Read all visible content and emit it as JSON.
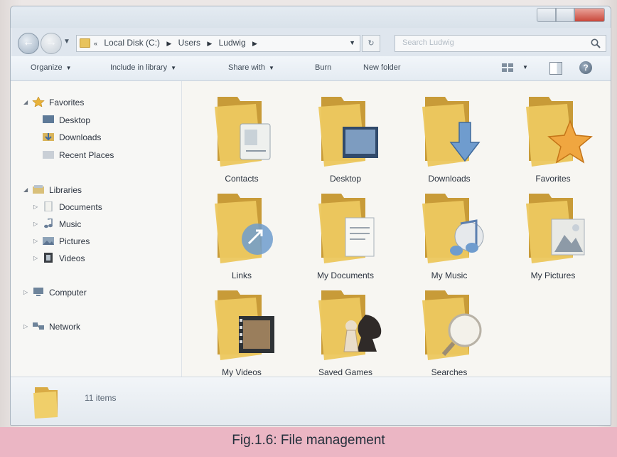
{
  "navbar": {
    "breadcrumbs": [
      "Local Disk (C:)",
      "Users",
      "Ludwig"
    ],
    "search_placeholder": "Search Ludwig"
  },
  "toolbar": {
    "organize": "Organize",
    "include_in_library": "Include in library",
    "share_with": "Share with",
    "burn": "Burn",
    "new_folder": "New folder"
  },
  "sidebar": {
    "favorites": {
      "label": "Favorites",
      "items": [
        "Desktop",
        "Downloads",
        "Recent Places"
      ]
    },
    "libraries": {
      "label": "Libraries",
      "items": [
        "Documents",
        "Music",
        "Pictures",
        "Videos"
      ]
    },
    "computer": "Computer",
    "network": "Network"
  },
  "folders": [
    {
      "name": "Contacts",
      "icon": "contact-card-icon"
    },
    {
      "name": "Desktop",
      "icon": "desktop-screen-icon"
    },
    {
      "name": "Downloads",
      "icon": "download-arrow-icon"
    },
    {
      "name": "Favorites",
      "icon": "star-icon"
    },
    {
      "name": "Links",
      "icon": "link-arrow-icon"
    },
    {
      "name": "My Documents",
      "icon": "document-page-icon"
    },
    {
      "name": "My Music",
      "icon": "music-note-icon"
    },
    {
      "name": "My Pictures",
      "icon": "landscape-photo-icon"
    },
    {
      "name": "My Videos",
      "icon": "film-strip-icon"
    },
    {
      "name": "Saved Games",
      "icon": "chess-pieces-icon"
    },
    {
      "name": "Searches",
      "icon": "magnifier-icon"
    }
  ],
  "details": {
    "item_count": "11 items"
  },
  "caption": "Fig.1.6: File management",
  "colors": {
    "folder": "#ecc85f",
    "folder_dark": "#c89b38",
    "caption_band": "#ebb6c4",
    "close_button": "#c9473a"
  }
}
